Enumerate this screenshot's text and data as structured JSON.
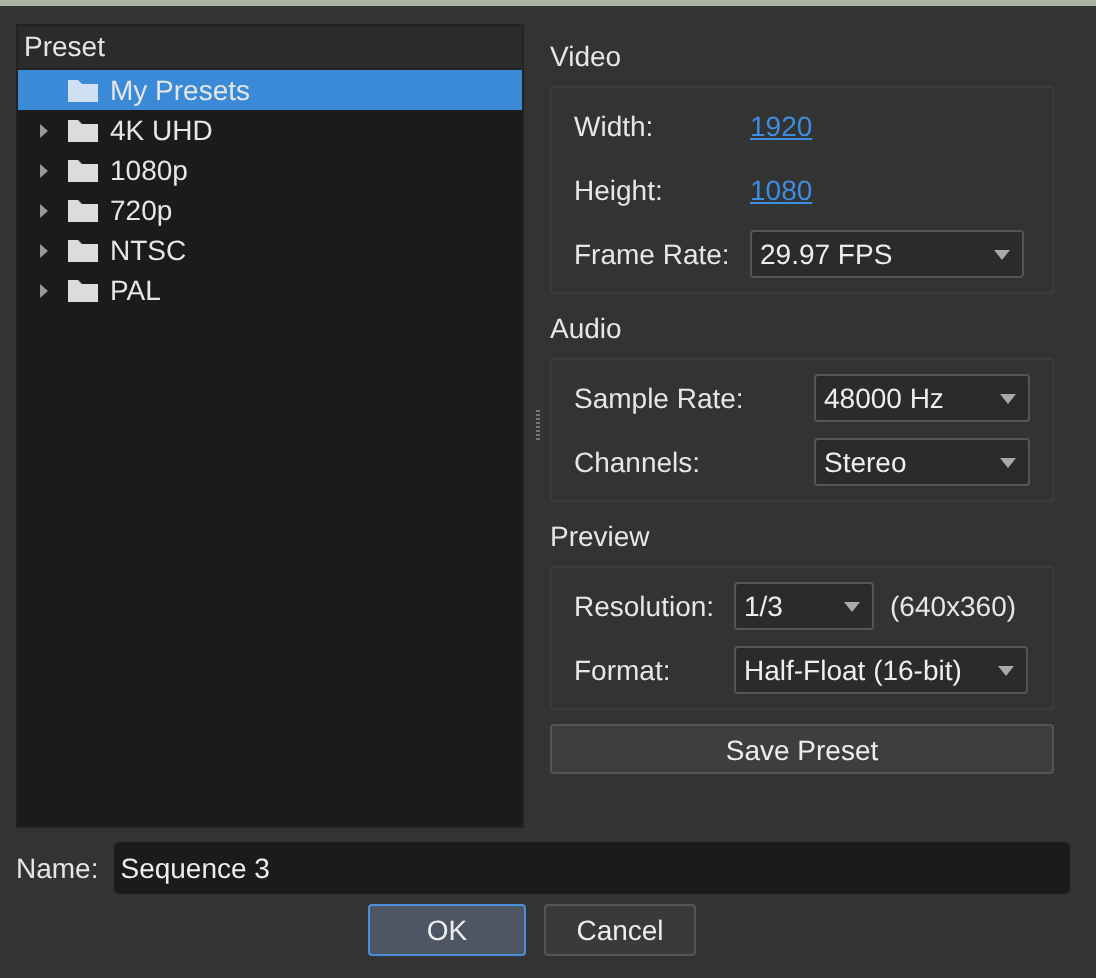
{
  "preset_panel": {
    "header": "Preset",
    "items": [
      {
        "label": "My Presets",
        "expandable": false,
        "selected": true
      },
      {
        "label": "4K UHD",
        "expandable": true,
        "selected": false
      },
      {
        "label": "1080p",
        "expandable": true,
        "selected": false
      },
      {
        "label": "720p",
        "expandable": true,
        "selected": false
      },
      {
        "label": "NTSC",
        "expandable": true,
        "selected": false
      },
      {
        "label": "PAL",
        "expandable": true,
        "selected": false
      }
    ]
  },
  "groups": [
    {
      "title": "Video",
      "rows": [
        {
          "kind": "link",
          "label": "Width:",
          "value": "1920"
        },
        {
          "kind": "link",
          "label": "Height:",
          "value": "1080"
        },
        {
          "kind": "select",
          "label": "Frame Rate:",
          "value": "29.97 FPS"
        }
      ]
    },
    {
      "title": "Audio",
      "rows": [
        {
          "kind": "select",
          "label": "Sample Rate:",
          "value": "48000 Hz"
        },
        {
          "kind": "select",
          "label": "Channels:",
          "value": "Stereo"
        }
      ]
    },
    {
      "title": "Preview",
      "rows": [
        {
          "kind": "select_note",
          "label": "Resolution:",
          "value": "1/3",
          "note": "(640x360)"
        },
        {
          "kind": "select",
          "label": "Format:",
          "value": "Half-Float (16-bit)"
        }
      ]
    }
  ],
  "save_button": "Save Preset",
  "name_field": {
    "label": "Name:",
    "value": "Sequence 3"
  },
  "buttons": [
    {
      "label": "OK",
      "default": true
    },
    {
      "label": "Cancel",
      "default": false
    }
  ]
}
